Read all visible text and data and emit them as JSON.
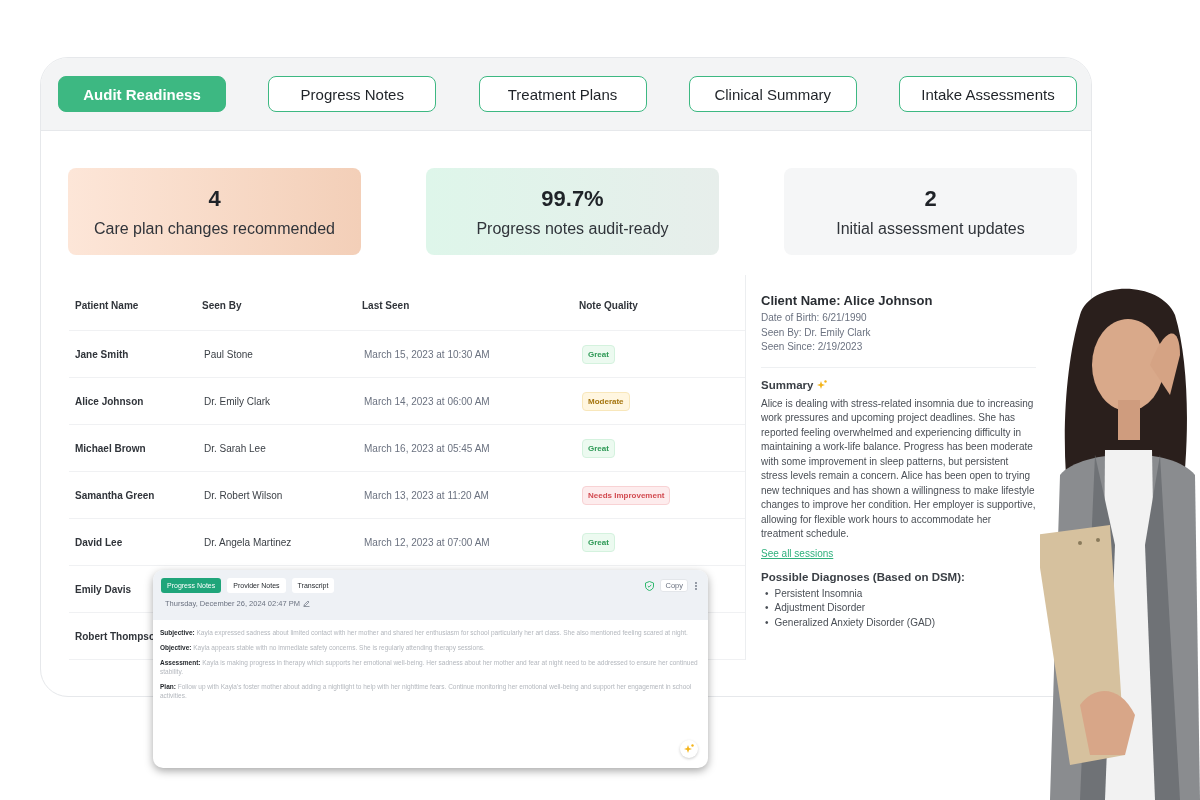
{
  "tabs": [
    {
      "label": "Audit Readiness",
      "selected": true
    },
    {
      "label": "Progress Notes",
      "selected": false
    },
    {
      "label": "Treatment Plans",
      "selected": false
    },
    {
      "label": "Clinical Summary",
      "selected": false
    },
    {
      "label": "Intake Assessments",
      "selected": false
    }
  ],
  "stats": [
    {
      "value": "4",
      "label": "Care plan changes recommended",
      "kind": "peach"
    },
    {
      "value": "99.7%",
      "label": "Progress notes audit-ready",
      "kind": "mint"
    },
    {
      "value": "2",
      "label": "Initial assessment updates",
      "kind": "plain"
    }
  ],
  "table": {
    "columns": [
      "Patient Name",
      "Seen By",
      "Last Seen",
      "Note Quality"
    ],
    "rows": [
      {
        "patient": "Jane Smith",
        "seen_by": "Paul Stone",
        "last_seen": "March 15, 2023 at 10:30 AM",
        "quality": {
          "label": "Great",
          "kind": "great"
        }
      },
      {
        "patient": "Alice Johnson",
        "seen_by": "Dr. Emily Clark",
        "last_seen": "March 14, 2023 at 06:00 AM",
        "quality": {
          "label": "Moderate",
          "kind": "moderate"
        }
      },
      {
        "patient": "Michael Brown",
        "seen_by": "Dr. Sarah Lee",
        "last_seen": "March 16, 2023 at 05:45 AM",
        "quality": {
          "label": "Great",
          "kind": "great"
        }
      },
      {
        "patient": "Samantha Green",
        "seen_by": "Dr. Robert Wilson",
        "last_seen": "March 13, 2023 at 11:20 AM",
        "quality": {
          "label": "Needs Improvement",
          "kind": "needs"
        }
      },
      {
        "patient": "David Lee",
        "seen_by": "Dr. Angela Martinez",
        "last_seen": "March 12, 2023 at 07:00 AM",
        "quality": {
          "label": "Great",
          "kind": "great"
        }
      },
      {
        "patient": "Emily Davis"
      },
      {
        "patient": "Robert Thompso"
      }
    ]
  },
  "detail": {
    "title": "Client Name: Alice Johnson",
    "meta": [
      "Date of Birth: 6/21/1990",
      "Seen By: Dr. Emily Clark",
      "Seen Since: 2/19/2023"
    ],
    "summary_heading": "Summary",
    "summary": "Alice is dealing with stress-related insomnia due to increasing work pressures and upcoming project deadlines. She has reported feeling overwhelmed and experiencing difficulty in maintaining a work-life balance. Progress has been moderate with some improvement in sleep patterns, but persistent stress levels remain a concern. Alice has been open to trying new techniques and has shown a willingness to make lifestyle changes to improve her condition. Her employer is supportive, allowing for flexible work hours to accommodate her treatment schedule.",
    "link": "See all sessions",
    "diagnoses_heading": "Possible Diagnoses (Based on DSM):",
    "diagnoses": [
      {
        "marker": "•",
        "text": "Persistent Insomnia"
      },
      {
        "marker": "•",
        "text": "Adjustment Disorder"
      },
      {
        "marker": "•",
        "text": "Generalized Anxiety Disorder (GAD)"
      }
    ]
  },
  "popup": {
    "tabs": [
      {
        "label": "Progress Notes",
        "selected": true
      },
      {
        "label": "Provider Notes",
        "selected": false
      },
      {
        "label": "Transcript",
        "selected": false
      }
    ],
    "copy": "Copy",
    "date": "Thursday, December 26, 2024 02:47 PM",
    "notes": [
      {
        "label": "Subjective:",
        "text": "Kayla expressed sadness about limited contact with her mother and shared her enthusiasm for school particularly her art class. She also mentioned feeling scared at night."
      },
      {
        "label": "Objective:",
        "text": "Kayla appears stable with no immediate safety concerns. She is regularly attending therapy sessions."
      },
      {
        "label": "Assessment:",
        "text": "Kayla is making progress in therapy which supports her emotional well-being. Her sadness about her mother and fear at night need to be addressed to ensure her continued stability."
      },
      {
        "label": "Plan:",
        "text": "Follow up with Kayla's foster mother about adding a nightlight to help with her nighttime fears. Continue monitoring her emotional well-being and support her engagement in school activities."
      }
    ]
  }
}
